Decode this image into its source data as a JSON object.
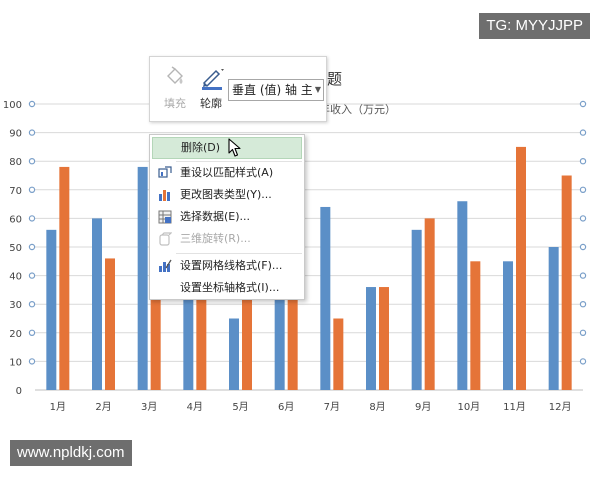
{
  "watermarks": {
    "top": "TG: MYYJJPP",
    "bottom": "www.npldkj.com"
  },
  "toolbar": {
    "fill_label": "填充",
    "outline_label": "轮廓",
    "element_selector": "垂直 (值) 轴 主要",
    "fill_icon": "paint-bucket-icon",
    "outline_icon": "pen-outline-icon",
    "dropdown_icon": "chevron-down-icon"
  },
  "chart_title_fragment": "题",
  "chart_subtitle_fragment": "年收入（万元）",
  "context_menu": {
    "items": [
      {
        "label": "删除(D)",
        "icon": "none",
        "state": "highlighted"
      },
      {
        "label": "重设以匹配样式(A)",
        "icon": "reset-style-icon",
        "state": "normal"
      },
      {
        "label": "更改图表类型(Y)...",
        "icon": "chart-type-icon",
        "state": "normal"
      },
      {
        "label": "选择数据(E)...",
        "icon": "select-data-icon",
        "state": "normal"
      },
      {
        "label": "三维旋转(R)...",
        "icon": "rotate-3d-icon",
        "state": "disabled"
      },
      {
        "label": "设置网格线格式(F)...",
        "icon": "gridlines-format-icon",
        "state": "normal"
      },
      {
        "label": "设置坐标轴格式(I)...",
        "icon": "none",
        "state": "normal"
      }
    ]
  },
  "colors": {
    "series1": "#5b8fc7",
    "series2": "#e57438",
    "gridline": "#d9d9d9",
    "handle": "#7a9fc9",
    "menu_highlight": "#d5ead8"
  },
  "chart_data": {
    "type": "bar",
    "categories": [
      "1月",
      "2月",
      "3月",
      "4月",
      "5月",
      "6月",
      "7月",
      "8月",
      "9月",
      "10月",
      "11月",
      "12月"
    ],
    "series": [
      {
        "values": [
          56,
          60,
          78,
          50,
          25,
          50,
          64,
          36,
          56,
          66,
          45,
          50
        ]
      },
      {
        "values": [
          78,
          46,
          50,
          50,
          50,
          50,
          25,
          36,
          60,
          45,
          85,
          75
        ]
      }
    ],
    "yticks": [
      "0",
      "10",
      "20",
      "30",
      "40",
      "50",
      "60",
      "70",
      "80",
      "90",
      "100"
    ],
    "ylim": [
      0,
      100
    ],
    "grid": true,
    "title": "",
    "xlabel": "",
    "ylabel": ""
  }
}
